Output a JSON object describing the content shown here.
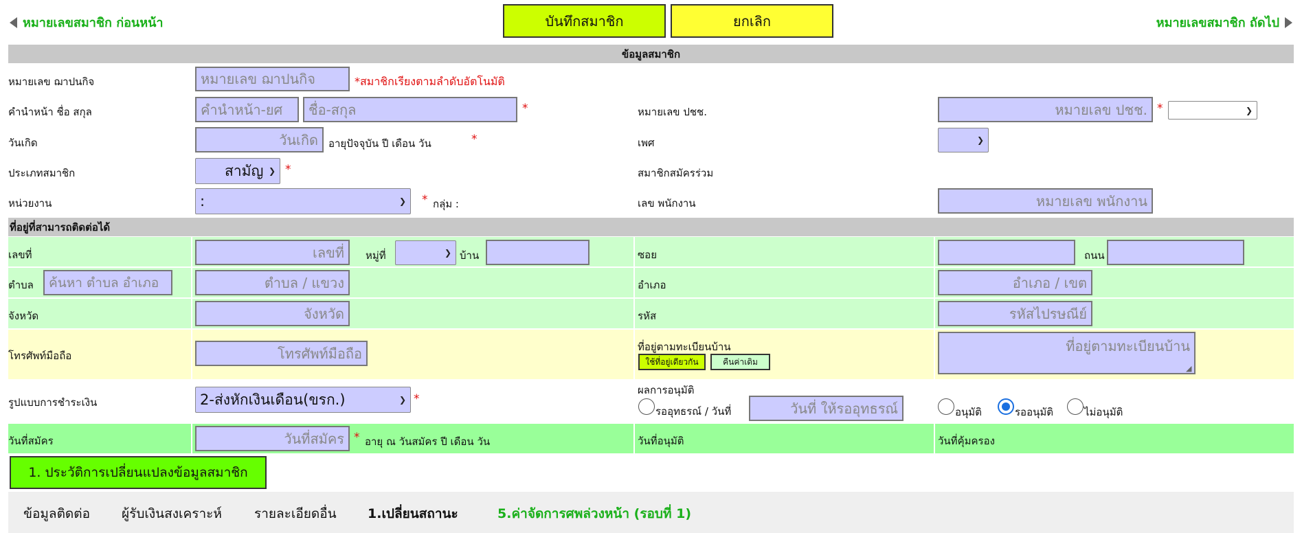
{
  "nav": {
    "prev": "หมายเลขสมาชิก ก่อนหน้า",
    "next": "หมายเลขสมาชิก ถัดไป",
    "save": "บันทึกสมาชิก",
    "cancel": "ยกเลิก"
  },
  "section_member": "ข้อมูลสมาชิก",
  "section_address": "ที่อยู่ที่สามารถติดต่อได้",
  "fields": {
    "fapankit_label": "หมายเลข ฌาปนกิจ",
    "fapankit_placeholder": "หมายเลข ฌาปนกิจ",
    "fapankit_note": "*สมาชิกเรียงตามลำดับอัตโนมัติ",
    "name_label": "คำนำหน้า ชื่อ สกุล",
    "prefix_placeholder": "คำนำหน้า-ยศ",
    "name_placeholder": "ชื่อ-สกุล",
    "idcard_label": "หมายเลข ปชช.",
    "idcard_placeholder": "หมายเลข ปชช.",
    "birth_label": "วันเกิด",
    "birth_placeholder": "วันเกิด",
    "age_text": "อายุปัจจุบัน  ปี เดือน วัน",
    "gender_label": "เพศ",
    "member_type_label": "ประเภทสมาชิก",
    "member_type_value": "สามัญ",
    "co_member_label": "สมาชิกสมัครร่วม",
    "unit_label": "หน่วยงาน",
    "unit_value": ":",
    "group_label": "กลุ่ม :",
    "employee_label": "เลข พนักงาน",
    "employee_placeholder": "หมายเลข พนักงาน"
  },
  "address": {
    "house_label": "เลขที่",
    "house_placeholder": "เลขที่",
    "moo_label": "หมู่ที่",
    "village_label": "บ้าน",
    "soi_label": "ซอย",
    "road_label": "ถนน",
    "tambon_label": "ตำบล",
    "tambon_search_placeholder": "ค้นหา ตำบล อำเภอ",
    "tambon_placeholder": "ตำบล / แขวง",
    "amphoe_label": "อำเภอ",
    "amphoe_placeholder": "อำเภอ / เขต",
    "province_label": "จังหวัด",
    "province_placeholder": "จังหวัด",
    "postcode_label": "รหัส",
    "postcode_placeholder": "รหัสไปรษณีย์",
    "mobile_label": "โทรศัพท์มือถือ",
    "mobile_placeholder": "โทรศัพท์มือถือ",
    "reg_address_label": "ที่อยู่ตามทะเบียนบ้าน",
    "reg_address_placeholder": "ที่อยู่ตามทะเบียนบ้าน",
    "same_address_button": "ใช้ที่อยู่เดียวกัน",
    "restore_button": "คืนค่าเดิม"
  },
  "payment": {
    "label": "รูปแบบการชำระเงิน",
    "value": "2-ส่งหักเงินเดือน(ขรก.)",
    "approval_label": "ผลการอนุมัติ",
    "appeal_text": "รออุทธรณ์ / วันที่",
    "appeal_placeholder": "วันที่ ให้รออุทธรณ์",
    "approve": "อนุมัติ",
    "pending": "รออนุมัติ",
    "reject": "ไม่อนุมัติ",
    "selected": "pending"
  },
  "apply": {
    "label": "วันที่สมัคร",
    "placeholder": "วันที่สมัคร",
    "age_text": "อายุ ณ วันสมัคร  ปี เดือน วัน",
    "approved_date_label": "วันที่อนุมัติ",
    "coverage_date_label": "วันที่คุ้มครอง"
  },
  "history_button": "1. ประวัติการเปลี่ยนแปลงข้อมูลสมาชิก",
  "tabs": [
    "ข้อมูลติดต่อ",
    "ผู้รับเงินสงเคราะห์",
    "รายละเอียดอื่น",
    "1.เปลี่ยนสถานะ",
    "5.ค่าจัดการศพล่วงหน้า (รอบที่ 1)"
  ],
  "colors": {
    "accent_green": "#1ab01a",
    "save_button": "#ccff00",
    "cancel_button": "#ffff33",
    "input_bg": "#ccccff",
    "row_green": "#ccffcc",
    "row_yellow": "#ffffcc",
    "row_bright_green": "#99ff99",
    "history_button": "#66ff00",
    "required": "#e01010"
  }
}
